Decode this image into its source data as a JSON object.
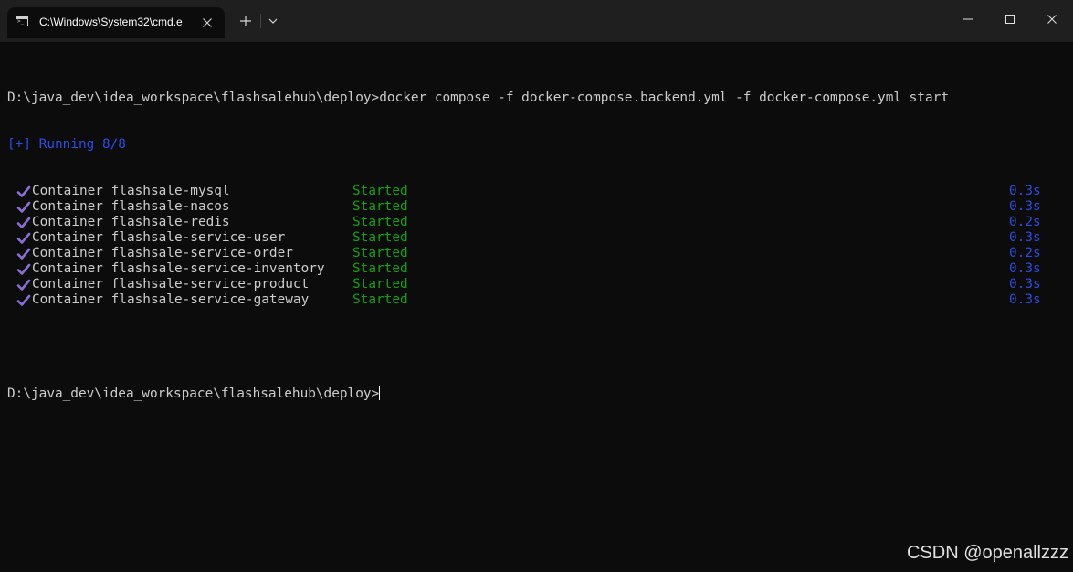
{
  "window": {
    "tab_title": "C:\\Windows\\System32\\cmd.e",
    "tab_icon": "cmd-icon",
    "new_tab_label": "+",
    "controls": [
      "minimize-icon",
      "maximize-icon",
      "close-icon"
    ]
  },
  "terminal": {
    "command_line": "D:\\java_dev\\idea_workspace\\flashsalehub\\deploy>docker compose -f docker-compose.backend.yml -f docker-compose.yml start",
    "running_status": "[+] Running 8/8",
    "containers": [
      {
        "name": "Container flashsale-mysql",
        "status": "Started",
        "time": "0.3s"
      },
      {
        "name": "Container flashsale-nacos",
        "status": "Started",
        "time": "0.3s"
      },
      {
        "name": "Container flashsale-redis",
        "status": "Started",
        "time": "0.2s"
      },
      {
        "name": "Container flashsale-service-user",
        "status": "Started",
        "time": "0.3s"
      },
      {
        "name": "Container flashsale-service-order",
        "status": "Started",
        "time": "0.2s"
      },
      {
        "name": "Container flashsale-service-inventory",
        "status": "Started",
        "time": "0.3s"
      },
      {
        "name": "Container flashsale-service-product",
        "status": "Started",
        "time": "0.3s"
      },
      {
        "name": "Container flashsale-service-gateway",
        "status": "Started",
        "time": "0.3s"
      }
    ],
    "prompt": "D:\\java_dev\\idea_workspace\\flashsalehub\\deploy>"
  },
  "colors": {
    "background": "#0c0c0c",
    "text": "#cccccc",
    "running": "#2b4ce6",
    "started": "#13a10e",
    "time": "#2b4ce6",
    "check": "#8b6fd6"
  },
  "watermark": "CSDN @openallzzz"
}
